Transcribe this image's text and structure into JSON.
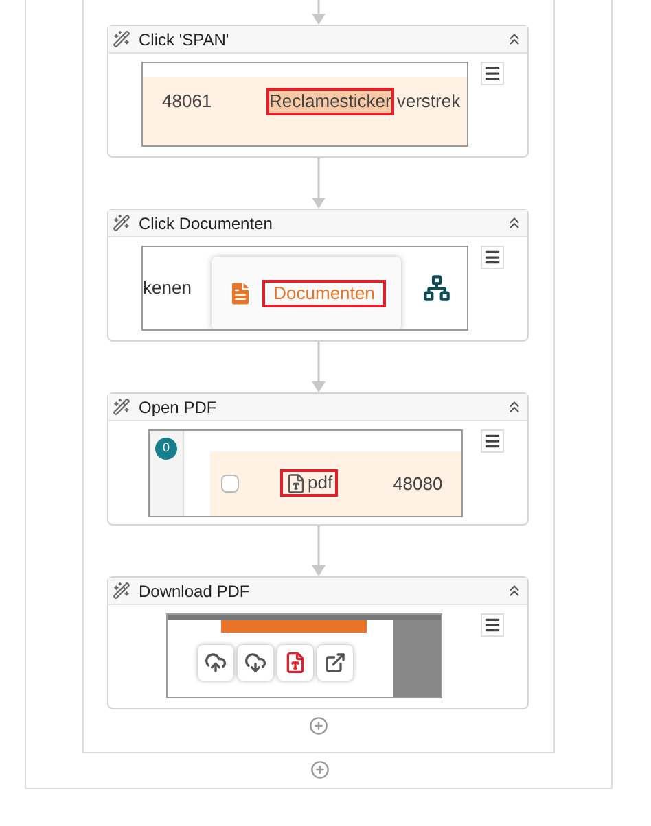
{
  "steps": [
    {
      "kind": "span",
      "title": "Click 'SPAN'",
      "expanded": true,
      "cells": [
        "48061",
        "Reclamesticker",
        "verstrek"
      ]
    },
    {
      "kind": "tab",
      "title": "Click Documenten",
      "expanded": true,
      "cells": [
        "kenen",
        "Documenten"
      ]
    },
    {
      "kind": "row",
      "title": "Open PDF",
      "expanded": true,
      "cells": [
        "0",
        "pdf",
        "48080"
      ],
      "checked": false
    },
    {
      "kind": "toolbar",
      "title": "Download PDF",
      "expanded": true
    }
  ]
}
